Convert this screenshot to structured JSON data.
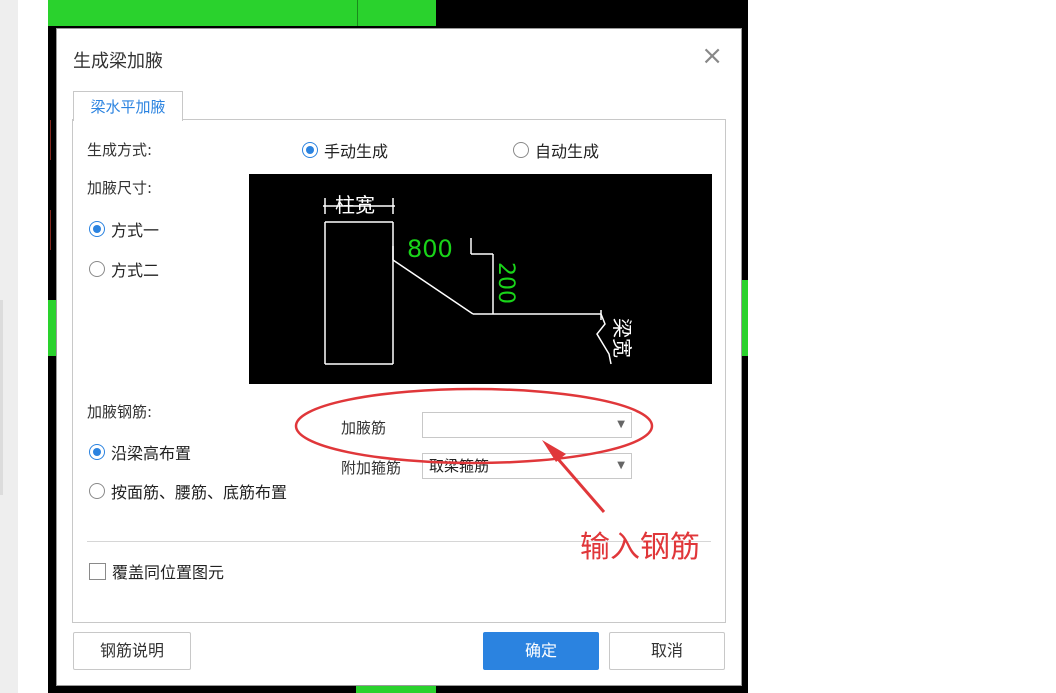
{
  "dialog": {
    "title": "生成梁加腋",
    "close_glyph": "×",
    "tab_label": "梁水平加腋",
    "gen_mode": {
      "label": "生成方式:",
      "options": [
        {
          "label": "手动生成",
          "selected": true
        },
        {
          "label": "自动生成",
          "selected": false
        }
      ]
    },
    "size": {
      "label": "加腋尺寸:",
      "options": [
        {
          "label": "方式一",
          "selected": true
        },
        {
          "label": "方式二",
          "selected": false
        }
      ]
    },
    "diagram": {
      "column_width": "柱宽",
      "dim_horizontal": "800",
      "dim_vertical": "200",
      "beam_width": "梁宽"
    },
    "rebar": {
      "label": "加腋钢筋:",
      "options": [
        {
          "label": "沿梁高布置",
          "selected": true
        },
        {
          "label": "按面筋、腰筋、底筋布置",
          "selected": false
        }
      ],
      "haunch_bar_label": "加腋筋",
      "haunch_bar_value": "",
      "extra_stirrup_label": "附加箍筋",
      "extra_stirrup_value": "取梁箍筋"
    },
    "overlay_checkbox": {
      "label": "覆盖同位置图元",
      "checked": false
    },
    "buttons": {
      "help": "钢筋说明",
      "ok": "确定",
      "cancel": "取消"
    }
  },
  "annotation": {
    "text": "输入钢筋",
    "color": "#e0373a"
  },
  "colors": {
    "accent": "#2b83e0",
    "dim_green": "#19d419"
  },
  "icons": {
    "close": "close-icon",
    "dropdown": "dropdown-arrow-icon"
  }
}
